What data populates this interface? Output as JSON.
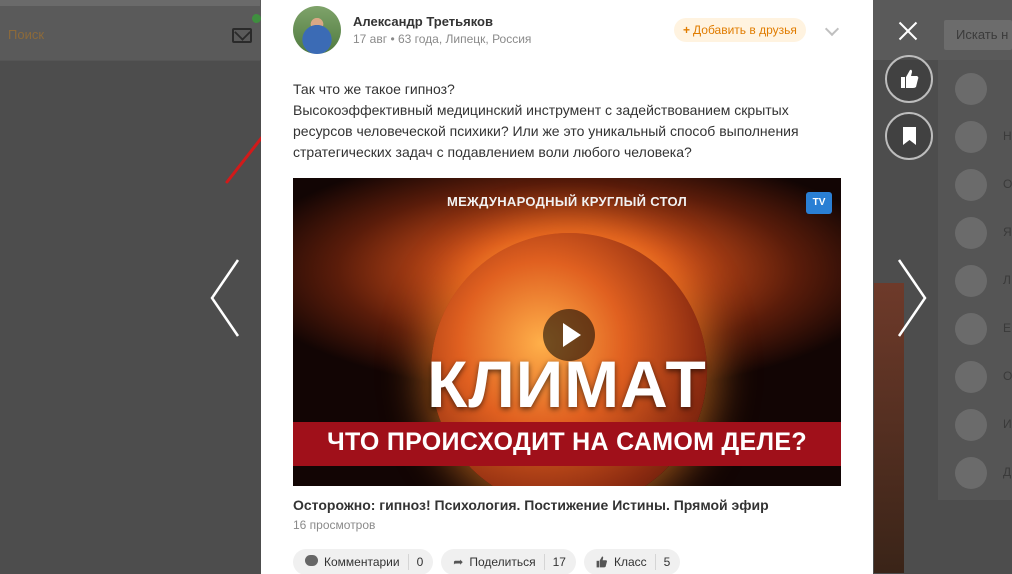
{
  "background_page": {
    "search_label": "Поиск",
    "right_search_placeholder": "Искать н",
    "right_list_letters": [
      "Н",
      "О",
      "Я",
      "Л",
      "Е",
      "О",
      "И",
      "Д"
    ]
  },
  "post": {
    "author": "Александр Третьяков",
    "meta": "17 авг • 63 года, Липецк, Россия",
    "add_friend_label": "Добавить в друзья",
    "text_lines": [
      "Так что же такое гипноз?",
      "Высокоэффективный медицинский инструмент с задействованием скрытых ресурсов человеческой психики? Или же это уникальный способ выполнения стратегических задач с подавлением воли любого человека?"
    ],
    "video": {
      "header": "МЕЖДУНАРОДНЫЙ КРУГЛЫЙ СТОЛ",
      "logo": "TV",
      "title": "КЛИМАТ",
      "subtitle": "ЧТО ПРОИСХОДИТ НА САМОМ ДЕЛЕ?",
      "link_title": "Осторожно: гипноз! Психология. Постижение Истины. Прямой эфир",
      "views": "16 просмотров"
    },
    "actions": [
      {
        "label": "Комментарии",
        "count": "0",
        "icon": "comment-icon"
      },
      {
        "label": "Поделиться",
        "count": "17",
        "icon": "share-icon"
      },
      {
        "label": "Класс",
        "count": "5",
        "icon": "thumbs-up-icon"
      }
    ]
  },
  "colors": {
    "accent_orange": "#e07c00",
    "overlay": "#4d4d4d"
  }
}
